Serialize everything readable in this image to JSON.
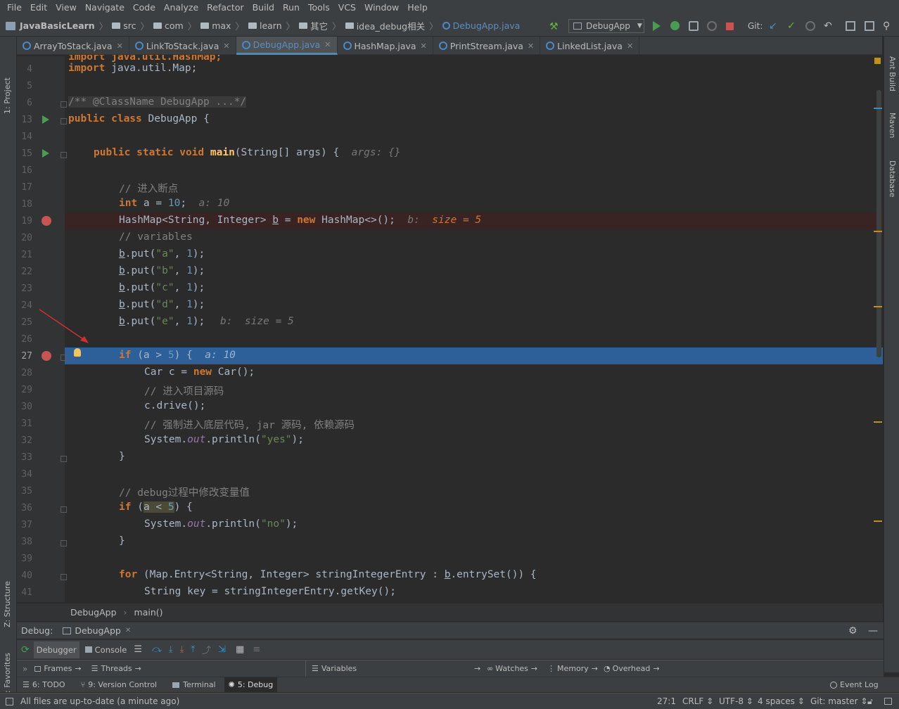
{
  "menu": [
    "File",
    "Edit",
    "View",
    "Navigate",
    "Code",
    "Analyze",
    "Refactor",
    "Build",
    "Run",
    "Tools",
    "VCS",
    "Window",
    "Help"
  ],
  "breadcrumbs": [
    "JavaBasicLearn",
    "src",
    "com",
    "max",
    "learn",
    "其它",
    "idea_debug相关",
    "DebugApp.java"
  ],
  "run_config": "DebugApp",
  "git_label": "Git:",
  "tabs": [
    {
      "label": "ArrayToStack.java",
      "active": false
    },
    {
      "label": "LinkToStack.java",
      "active": false
    },
    {
      "label": "DebugApp.java",
      "active": true
    },
    {
      "label": "HashMap.java",
      "active": false
    },
    {
      "label": "PrintStream.java",
      "active": false
    },
    {
      "label": "LinkedList.java",
      "active": false
    }
  ],
  "left_strip": {
    "project": "1: Project",
    "structure": "Z: Structure",
    "favorites": "2: Favorites"
  },
  "right_strip": {
    "ant": "Ant Build",
    "maven": "Maven",
    "database": "Database"
  },
  "code": {
    "line3": "import java.util.HashMap;",
    "l4_kw": "import",
    "l4_rest": " java.util.Map;",
    "l6": "/** @ClassName DebugApp ...*/",
    "l13_kw": "public class",
    "l13_rest": " DebugApp {",
    "l15_kw": "public static void",
    "l15_fn": "main",
    "l15_rest": "(String[] args) {",
    "l15_dbg": "args: {}",
    "l17": "// 进入断点",
    "l18_kw": "int",
    "l18_rest": " a = ",
    "l18_num": "10",
    "l18_end": ";",
    "l18_dbg": "a: 10",
    "l19_a": "HashMap<String, Integer> ",
    "l19_b": "b",
    "l19_c": " = ",
    "l19_kw": "new",
    "l19_d": " HashMap<>();",
    "l19_dbg": "b:",
    "l19_dbgv": "size = 5",
    "l20": "// variables",
    "put_lines": [
      {
        "key": "\"a\"",
        "val": "1"
      },
      {
        "key": "\"b\"",
        "val": "1"
      },
      {
        "key": "\"c\"",
        "val": "1"
      },
      {
        "key": "\"d\"",
        "val": "1"
      },
      {
        "key": "\"e\"",
        "val": "1"
      }
    ],
    "b_var": "b",
    "put_open": ".put(",
    "put_comma": ", ",
    "put_close": ");",
    "l25_dbg": "b:  size = 5",
    "l27_kw": "if",
    "l27_rest": " (a > ",
    "l27_num": "5",
    "l27_end": ") {",
    "l27_dbg": "a: 10",
    "l28_a": "Car c = ",
    "l28_kw": "new",
    "l28_b": " Car();",
    "l29": "// 进入项目源码",
    "l30": "c.drive();",
    "l31": "// 强制进入底层代码, jar 源码, 依赖源码",
    "l32_a": "System.",
    "l32_out": "out",
    "l32_b": ".println(",
    "l32_str": "\"yes\"",
    "l32_c": ");",
    "l33": "}",
    "l35": "// debug过程中修改变量值",
    "l36_kw": "if",
    "l36_a": " (",
    "l36_b": "a < ",
    "l36_num": "5",
    "l36_c": ") {",
    "l37_a": "System.",
    "l37_out": "out",
    "l37_b": ".println(",
    "l37_str": "\"no\"",
    "l37_c": ");",
    "l38": "}",
    "l40_kw": "for",
    "l40_a": " (Map.Entry<String, Integer> stringIntegerEntry : ",
    "l40_b": "b",
    "l40_c": ".entrySet()) {",
    "l41": "String key = stringIntegerEntry.getKey();"
  },
  "line_numbers": [
    "4",
    "5",
    "6",
    "13",
    "14",
    "15",
    "16",
    "17",
    "18",
    "19",
    "20",
    "21",
    "22",
    "23",
    "24",
    "25",
    "26",
    "27",
    "28",
    "29",
    "30",
    "31",
    "32",
    "33",
    "34",
    "35",
    "36",
    "37",
    "38",
    "39",
    "40",
    "41"
  ],
  "editor_breadcrumb": [
    "DebugApp",
    "main()"
  ],
  "debug": {
    "label": "Debug:",
    "session": "DebugApp",
    "tab_debugger": "Debugger",
    "tab_console": "Console",
    "frames": "Frames",
    "threads": "Threads",
    "variables": "Variables",
    "watches": "Watches",
    "memory": "Memory",
    "overhead": "Overhead"
  },
  "toolwindows": [
    {
      "label": "6: TODO"
    },
    {
      "label": "9: Version Control"
    },
    {
      "label": "Terminal"
    },
    {
      "label": "5: Debug"
    }
  ],
  "event_log": "Event Log",
  "status": {
    "message": "All files are up-to-date (a minute ago)",
    "position": "27:1",
    "line_sep": "CRLF",
    "encoding": "UTF-8",
    "indent": "4 spaces",
    "git": "Git: master"
  },
  "colors": {
    "accent": "#4a88c7",
    "highlight_line": "#2d6099",
    "breakpoint_line": "#3a2323",
    "breakpoint": "#c75450",
    "keyword": "#cc7832",
    "string": "#6a8759",
    "number": "#6897bb"
  }
}
